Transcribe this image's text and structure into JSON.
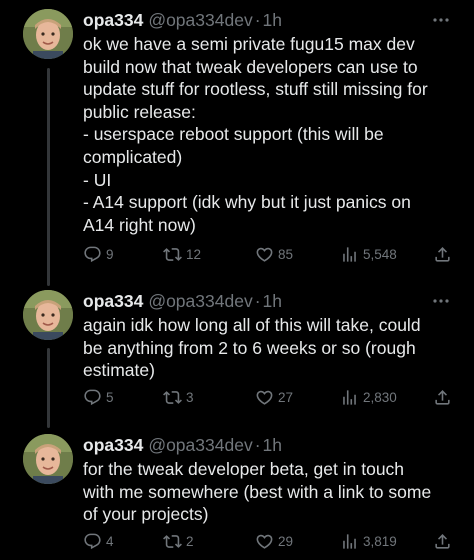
{
  "tweets": [
    {
      "name": "opa334",
      "handle": "@opa334dev",
      "separator": "·",
      "time": "1h",
      "lines": [
        "ok we have a semi private fugu15 max dev",
        "build now that tweak developers can use to",
        "update stuff for rootless, stuff still missing for",
        "public release:",
        "- userspace reboot support (this will be",
        "complicated)",
        "- UI",
        "- A14 support (idk why but it just panics on",
        "A14 right now)"
      ],
      "replies": "9",
      "retweets": "12",
      "likes": "85",
      "views": "5,548"
    },
    {
      "name": "opa334",
      "handle": "@opa334dev",
      "separator": "·",
      "time": "1h",
      "lines": [
        "again idk how long all of this will take, could",
        "be anything from 2 to 6 weeks or so (rough",
        "estimate)"
      ],
      "replies": "5",
      "retweets": "3",
      "likes": "27",
      "views": "2,830"
    },
    {
      "name": "opa334",
      "handle": "@opa334dev",
      "separator": "·",
      "time": "1h",
      "lines": [
        "for the tweak developer beta, get in touch",
        "with me somewhere (best with a link to some",
        "of your projects)"
      ],
      "replies": "4",
      "retweets": "2",
      "likes": "29",
      "views": "3,819"
    }
  ],
  "icons": {
    "reply": "reply-icon",
    "retweet": "retweet-icon",
    "like": "heart-icon",
    "views": "views-chart-icon",
    "share": "share-icon",
    "more": "more-dots-icon"
  },
  "colors": {
    "background": "#000000",
    "text": "#e7e9ea",
    "muted": "#71767b",
    "thread_line": "#333639"
  }
}
